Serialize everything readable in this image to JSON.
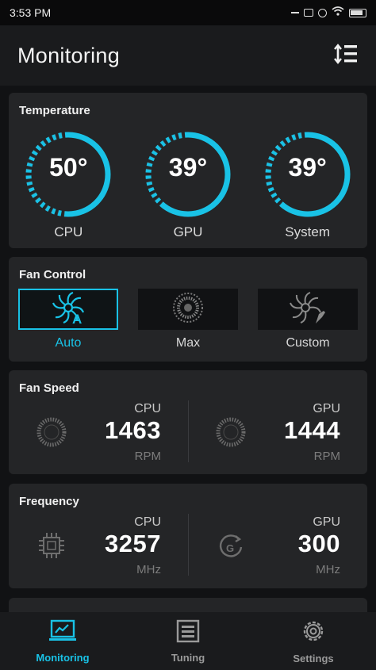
{
  "status": {
    "time": "3:53 PM"
  },
  "appbar": {
    "title": "Monitoring",
    "sort_icon": "sort-icon"
  },
  "temperature": {
    "title": "Temperature",
    "gauges": [
      {
        "value": "50°",
        "label": "CPU",
        "level": 0.5
      },
      {
        "value": "39°",
        "label": "GPU",
        "level": 0.39
      },
      {
        "value": "39°",
        "label": "System",
        "level": 0.39
      }
    ]
  },
  "fan_control": {
    "title": "Fan Control",
    "modes": [
      {
        "label": "Auto",
        "icon": "fan-auto-icon",
        "active": true
      },
      {
        "label": "Max",
        "icon": "fan-max-icon",
        "active": false
      },
      {
        "label": "Custom",
        "icon": "fan-custom-icon",
        "active": false
      }
    ]
  },
  "fan_speed": {
    "title": "Fan Speed",
    "cpu": {
      "name": "CPU",
      "value": "1463",
      "unit": "RPM"
    },
    "gpu": {
      "name": "GPU",
      "value": "1444",
      "unit": "RPM"
    }
  },
  "frequency": {
    "title": "Frequency",
    "cpu": {
      "name": "CPU",
      "value": "3257",
      "unit": "MHz"
    },
    "gpu": {
      "name": "GPU",
      "value": "300",
      "unit": "MHz"
    }
  },
  "nav": {
    "items": [
      {
        "label": "Monitoring",
        "icon": "monitor-chart-icon",
        "active": true
      },
      {
        "label": "Tuning",
        "icon": "tuning-icon",
        "active": false
      },
      {
        "label": "Settings",
        "icon": "gear-icon",
        "active": false
      }
    ]
  },
  "colors": {
    "accent": "#19c2e6",
    "card": "#242527",
    "background": "#111214"
  }
}
